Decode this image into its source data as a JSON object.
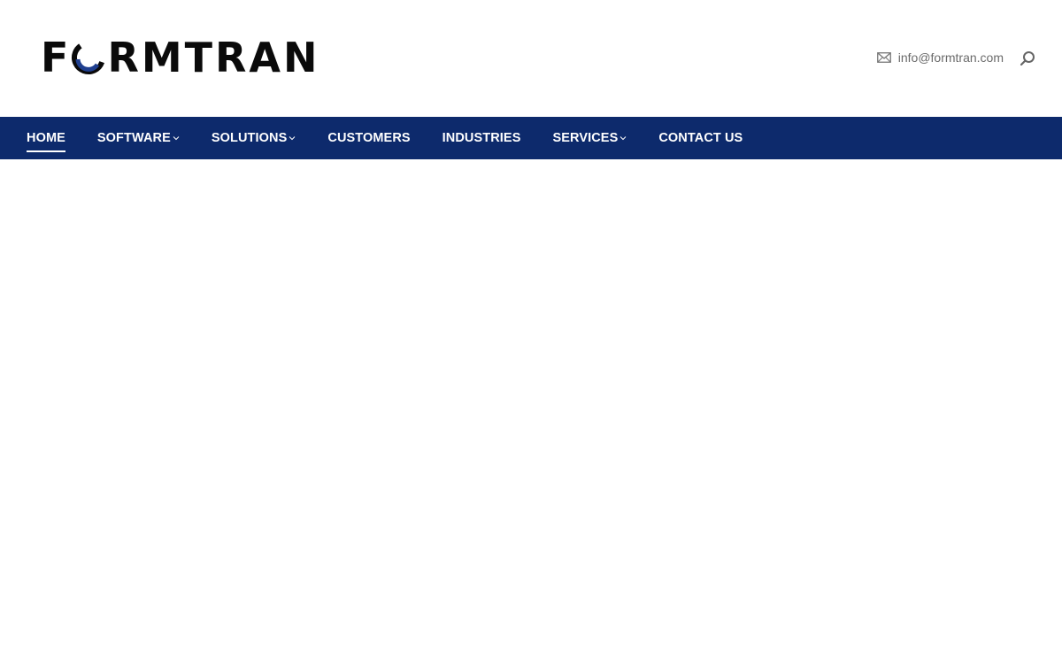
{
  "brand": {
    "logo_text_prefix": "F",
    "logo_text_suffix": "RMTRAN",
    "logo_colors": {
      "text": "#0a0a0a",
      "accent": "#1f3f8f"
    }
  },
  "header": {
    "email": "info@formtran.com",
    "email_icon": "mail-icon",
    "search_icon": "search-icon"
  },
  "nav": {
    "background": "#0d2a6c",
    "items": [
      {
        "label": "HOME",
        "active": true,
        "has_dropdown": false
      },
      {
        "label": "SOFTWARE",
        "active": false,
        "has_dropdown": true
      },
      {
        "label": "SOLUTIONS",
        "active": false,
        "has_dropdown": true
      },
      {
        "label": "CUSTOMERS",
        "active": false,
        "has_dropdown": false
      },
      {
        "label": "INDUSTRIES",
        "active": false,
        "has_dropdown": false
      },
      {
        "label": "SERVICES",
        "active": false,
        "has_dropdown": true
      },
      {
        "label": "CONTACT US",
        "active": false,
        "has_dropdown": false
      }
    ]
  }
}
